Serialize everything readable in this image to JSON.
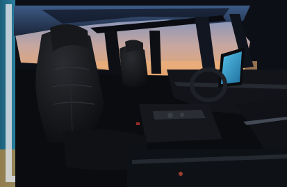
{
  "scene": {
    "subject": "car-interior-photo",
    "colors": {
      "sky_top": "#6f8fc4",
      "sky_horizon": "#e9a56a",
      "leather": "#141518",
      "frame": "#d9dde3",
      "screen": "#2fa6d8",
      "left_edge": "#2a7f9e"
    }
  }
}
